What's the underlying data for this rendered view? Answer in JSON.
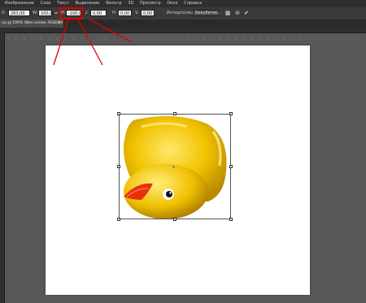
{
  "menu": {
    "items": [
      "Изображение",
      "Слои",
      "Текст",
      "Выделение",
      "Фильтр",
      "3D",
      "Просмотр",
      "Окно",
      "Справка"
    ]
  },
  "options": {
    "x_label": "X:",
    "x_value": "283,00 пикс",
    "w_label": "W:",
    "w_value": "100,00%",
    "h_label": "H:",
    "h_value": "-100,00%",
    "angle_label": "∠",
    "angle_value": "0,00",
    "hskew_label": "H:",
    "hskew_value": "0,00",
    "vskew_label": "V:",
    "vskew_value": "0,00",
    "interp_label": "Интерполяция:",
    "interp_value": "Бикубичес..."
  },
  "tab": {
    "label": "нр @ 100% (Фон копия, RGB/8*) *"
  },
  "colors": {
    "highlight": "#e00000",
    "annotation": "#e00000",
    "duck_body": "#f2c200",
    "beak": "#e83010"
  },
  "icons": {
    "warp": "warp-icon",
    "cancel": "cancel-icon",
    "commit": "check-icon",
    "link": "link-icon"
  }
}
